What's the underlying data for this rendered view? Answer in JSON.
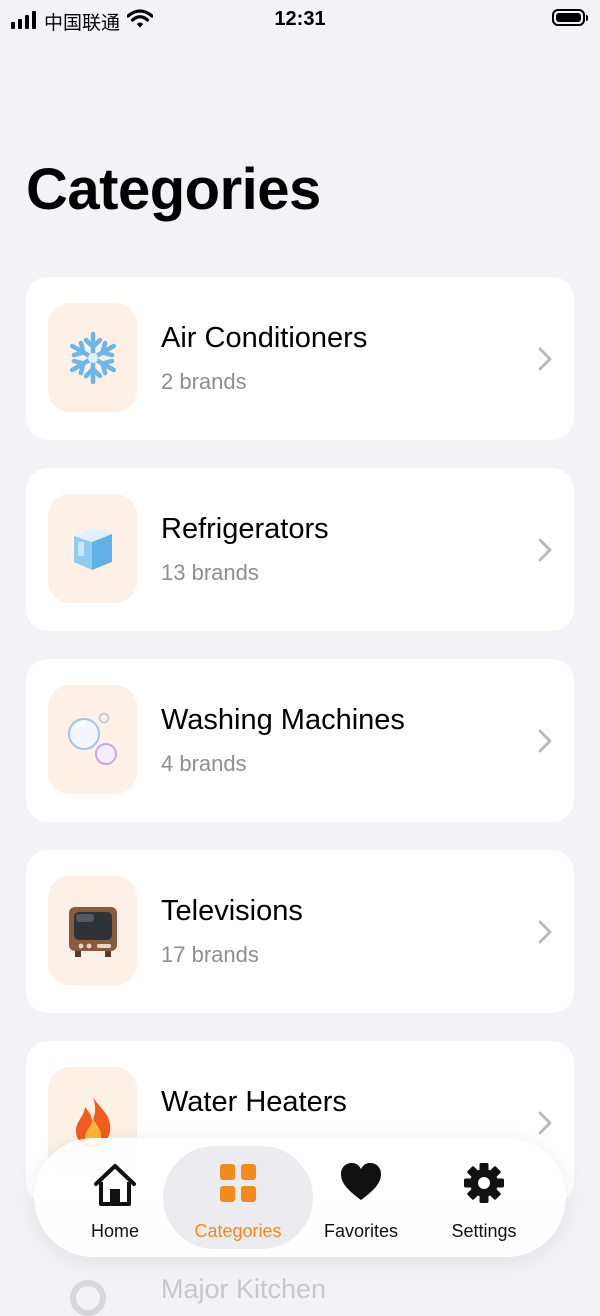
{
  "status_bar": {
    "carrier": "中国联通",
    "time": "12:31"
  },
  "page_title": "Categories",
  "categories": [
    {
      "name": "Air Conditioners",
      "count": "2 brands",
      "icon": "snowflake-icon"
    },
    {
      "name": "Refrigerators",
      "count": "13 brands",
      "icon": "ice-cube-icon"
    },
    {
      "name": "Washing Machines",
      "count": "4 brands",
      "icon": "bubbles-icon"
    },
    {
      "name": "Televisions",
      "count": "17 brands",
      "icon": "television-icon"
    },
    {
      "name": "Water Heaters",
      "count": "",
      "icon": "fire-icon"
    }
  ],
  "partial_item": {
    "name": "Major Kitchen"
  },
  "tabs": [
    {
      "label": "Home",
      "icon": "home-icon",
      "active": false
    },
    {
      "label": "Categories",
      "icon": "grid-icon",
      "active": true
    },
    {
      "label": "Favorites",
      "icon": "heart-icon",
      "active": false
    },
    {
      "label": "Settings",
      "icon": "gear-icon",
      "active": false
    }
  ],
  "colors": {
    "accent": "#f28a1c",
    "icon_tile": "#fdf0e6",
    "background": "#f2f2f7"
  }
}
